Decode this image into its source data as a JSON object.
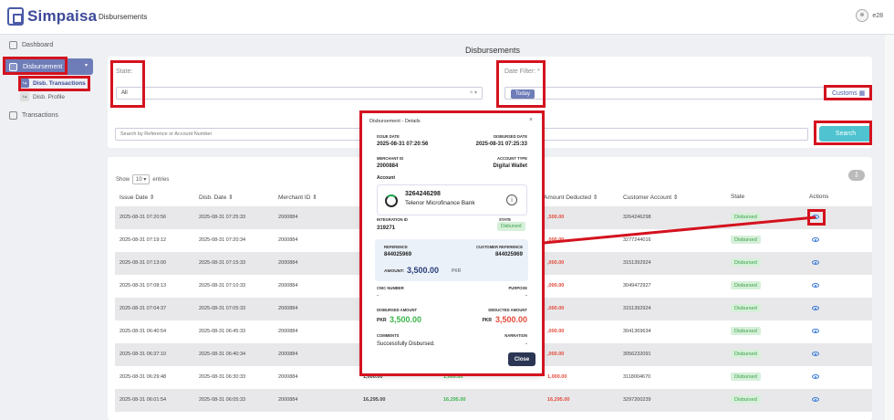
{
  "brand": {
    "name": "Simpaisa"
  },
  "topbar": {
    "title": "Disbursements",
    "user": "e28"
  },
  "sidebar": {
    "items": [
      {
        "label": "Dashboard"
      },
      {
        "label": "Disbursement"
      },
      {
        "label": "Transactions"
      }
    ],
    "subitems": [
      {
        "label": "Disb. Transactions"
      },
      {
        "label": "Disb. Profile"
      }
    ]
  },
  "page": {
    "title": "Disbursements"
  },
  "filters": {
    "state_label": "State:",
    "state_value": "All",
    "date_label": "Date Filter: *",
    "date_value": "Today",
    "customs_label": "Customs",
    "search_placeholder": "Search by Reference or Account Number",
    "search_button": "Search"
  },
  "table": {
    "show_label": "Show",
    "page_size": "10",
    "entries_label": "entries",
    "headers": [
      "Issue Date",
      "Disb. Date",
      "Merchant ID",
      "Amount Deducted",
      "Customer Account",
      "State",
      "Actions"
    ],
    "rows": [
      {
        "issue": "2025-08-31 07:20:56",
        "disb": "2025-08-31 07:25:33",
        "merchant": "2000884",
        "disbursed": "",
        "deducted": "3,500.00",
        "deducted_visible": ",500.00",
        "account": "3264246298",
        "state": "Disbursed"
      },
      {
        "issue": "2025-08-31 07:19:12",
        "disb": "2025-08-31 07:20:34",
        "merchant": "2000884",
        "disbursed": "",
        "deducted": ",000.00",
        "account": "3277244016",
        "state": "Disbursed"
      },
      {
        "issue": "2025-08-31 07:13:00",
        "disb": "2025-08-31 07:15:33",
        "merchant": "2000884",
        "disbursed": "",
        "deducted": ",000.00",
        "account": "3151392924",
        "state": "Disbursed"
      },
      {
        "issue": "2025-08-31 07:08:13",
        "disb": "2025-08-31 07:10:33",
        "merchant": "2000884",
        "disbursed": "",
        "deducted": ",000.00",
        "account": "3049472927",
        "state": "Disbursed"
      },
      {
        "issue": "2025-08-31 07:04:37",
        "disb": "2025-08-31 07:05:33",
        "merchant": "2000884",
        "disbursed": "",
        "deducted": ",000.00",
        "account": "3151392924",
        "state": "Disbursed"
      },
      {
        "issue": "2025-08-31 06:40:54",
        "disb": "2025-08-31 06:45:33",
        "merchant": "2000884",
        "disbursed": "",
        "deducted": ",000.00",
        "account": "3041369634",
        "state": "Disbursed"
      },
      {
        "issue": "2025-08-31 06:37:10",
        "disb": "2025-08-31 06:40:34",
        "merchant": "2000884",
        "disbursed": "",
        "deducted": ",000.00",
        "account": "3056232091",
        "state": "Disbursed"
      },
      {
        "issue": "2025-08-31 06:29:48",
        "disb": "2025-08-31 06:30:33",
        "merchant": "2000884",
        "amount": "1,000.00",
        "disbursed": "1,000.00",
        "deducted": "1,000.00",
        "account": "3118004670",
        "state": "Disbursed"
      },
      {
        "issue": "2025-08-31 06:01:54",
        "disb": "2025-08-31 06:05:33",
        "merchant": "2000884",
        "amount": "16,295.00",
        "disbursed": "16,295.00",
        "deducted": "16,295.00",
        "account": "3297200239",
        "state": "Disbursed"
      }
    ]
  },
  "modal": {
    "title": "Disbursement - Details",
    "close": "×",
    "issue_date_label": "ISSUE DATE",
    "issue_date": "2025-08-31 07:20:56",
    "disbursed_date_label": "DISBURSED DATE",
    "disbursed_date": "2025-08-31 07:25:33",
    "merchant_id_label": "MERCHANT ID",
    "merchant_id": "2000884",
    "account_type_label": "ACCOUNT TYPE",
    "account_type": "Digital Wallet",
    "account_label": "Account",
    "account_number": "3264246298",
    "bank_name": "Telenor Microfinance Bank",
    "integration_id_label": "INTEGRATION ID",
    "integration_id": "319271",
    "state_label": "STATE",
    "state": "Disbursed",
    "reference_label": "REFERENCE",
    "reference": "844025969",
    "customer_reference_label": "CUSTOMER REFERENCE",
    "customer_reference": "844025969",
    "amount_label": "AMOUNT:",
    "amount": "3,500.00",
    "amount_currency": "PKR",
    "cnic_label": "CNIC NUMBER",
    "cnic": "-",
    "purpose_label": "PURPOSE",
    "purpose": "-",
    "disbursed_amount_label": "DISBURSED AMOUNT",
    "disbursed_amount": "3,500.00",
    "deducted_amount_label": "DEDUCTED AMOUNT",
    "deducted_amount": "3,500.00",
    "currency": "PKR",
    "comments_label": "COMMENTS",
    "comments": "Successfully Disbursed.",
    "narration_label": "NARRATION",
    "narration": "-",
    "close_button": "Close"
  },
  "colors": {
    "accent": "#6e7db8",
    "highlight": "#d4121e",
    "success": "#3bb44a",
    "danger": "#e24a3b",
    "search": "#4fc3cf"
  }
}
